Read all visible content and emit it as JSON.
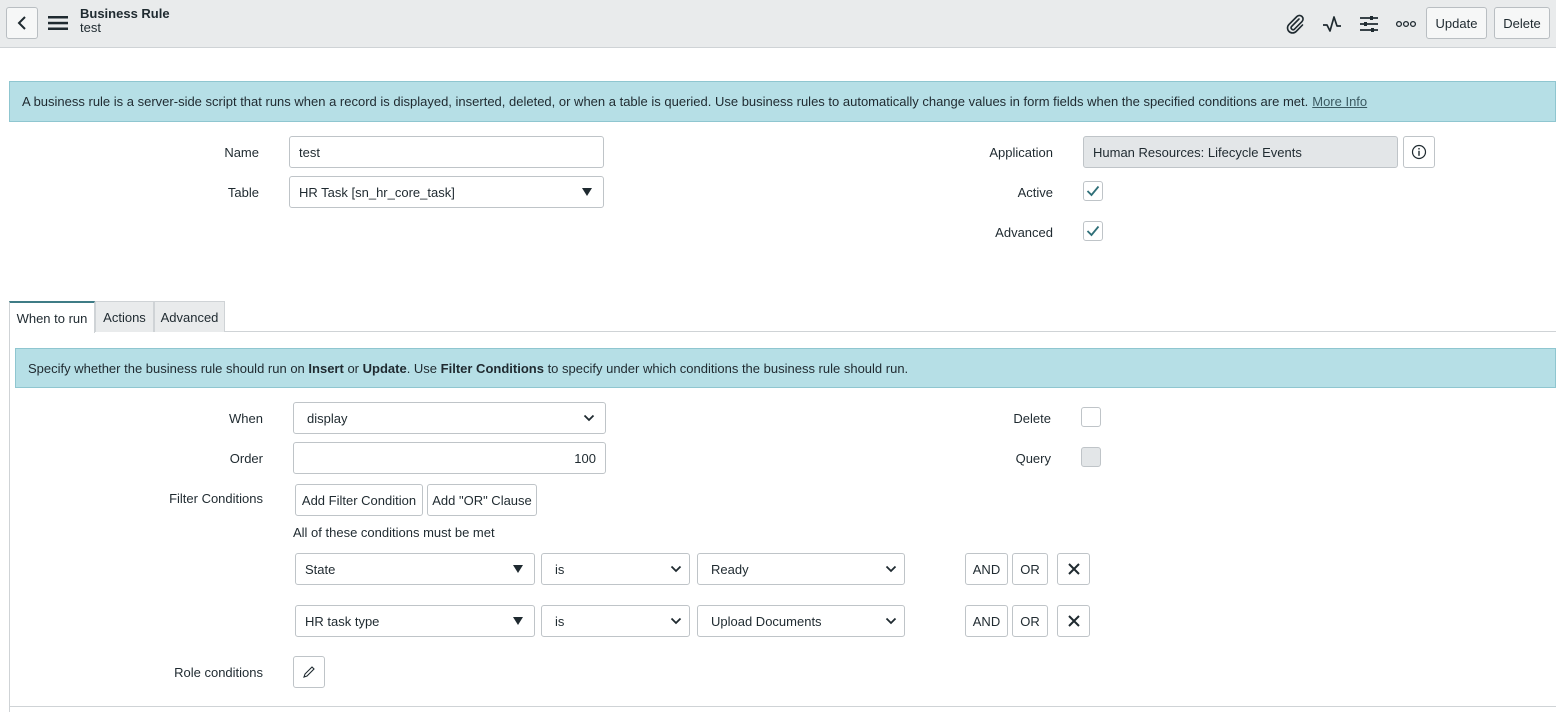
{
  "header": {
    "title": "Business Rule",
    "subtitle": "test",
    "update_label": "Update",
    "delete_label": "Delete"
  },
  "info_banner": {
    "text": "A business rule is a server-side script that runs when a record is displayed, inserted, deleted, or when a table is queried. Use business rules to automatically change values in form fields when the specified conditions are met.",
    "link": "More Info"
  },
  "form": {
    "name_label": "Name",
    "name_value": "test",
    "table_label": "Table",
    "table_value": "HR Task [sn_hr_core_task]",
    "application_label": "Application",
    "application_value": "Human Resources: Lifecycle Events",
    "active_label": "Active",
    "active_checked": true,
    "advanced_label": "Advanced",
    "advanced_checked": true
  },
  "tabs": [
    {
      "label": "When to run",
      "active": true
    },
    {
      "label": "Actions",
      "active": false
    },
    {
      "label": "Advanced",
      "active": false
    }
  ],
  "when_banner": {
    "part1": "Specify whether the business rule should run on",
    "insert": "Insert",
    "or": "or",
    "update": "Update",
    "part2": ". Use",
    "filter": "Filter Conditions",
    "part3": "to specify under which conditions the business rule should run."
  },
  "when_to_run": {
    "when_label": "When",
    "when_value": "display",
    "order_label": "Order",
    "order_value": "100",
    "delete_label": "Delete",
    "delete_checked": false,
    "query_label": "Query",
    "query_checked": false,
    "filter_label": "Filter Conditions",
    "add_filter_label": "Add Filter Condition",
    "add_or_label": "Add \"OR\" Clause",
    "conditions_note": "All of these conditions must be met",
    "role_label": "Role conditions"
  },
  "conditions": [
    {
      "field": "State",
      "operator": "is",
      "value": "Ready",
      "and": "AND",
      "or": "OR"
    },
    {
      "field": "HR task type",
      "operator": "is",
      "value": "Upload Documents",
      "and": "AND",
      "or": "OR"
    }
  ],
  "colors": {
    "banner_bg": "#b6dfe6",
    "check_color": "#2f6f78",
    "header_bg": "#e9ebec"
  }
}
